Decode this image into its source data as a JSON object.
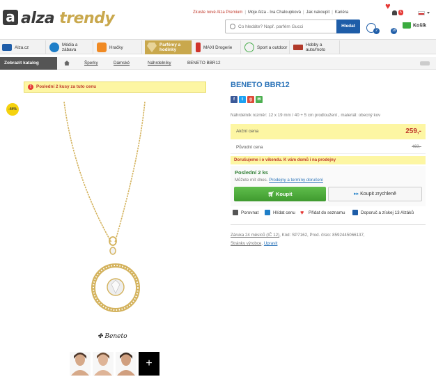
{
  "header": {
    "logo_letter": "a",
    "logo_word1": "alza",
    "logo_word2": "trendy",
    "links": [
      "Zkuste nové Alza Premium",
      "Moje Alza - Iva Chaloupková",
      "Jak nakoupit",
      "Kariéra"
    ],
    "notification_count": "5",
    "search_placeholder": "Co hledáte? Např. parfém Gucci",
    "search_button": "Hledat",
    "compare_count": "2",
    "favorites_count": "18",
    "cart_label": "Košík"
  },
  "nav": [
    {
      "label": "Alza.cz",
      "icon": "laptop-icon",
      "color": "#1e5da8"
    },
    {
      "label": "Média a zábava",
      "icon": "play-icon",
      "color": "#1e7ec8"
    },
    {
      "label": "Hračky",
      "icon": "robot-icon",
      "color": "#f08a24"
    },
    {
      "label": "Parfémy a hodinky",
      "icon": "diamond-icon",
      "color": "#ffffff"
    },
    {
      "label": "MAXI Drogerie",
      "icon": "bottle-icon",
      "color": "#d0342c"
    },
    {
      "label": "Sport a outdoor",
      "icon": "bike-icon",
      "color": "#4caf50"
    },
    {
      "label": "Hobby a auto/moto",
      "icon": "drill-icon",
      "color": "#b13a2a"
    }
  ],
  "breadcrumb": {
    "catalog_button": "Zobrazit katalog",
    "items": [
      "Šperky",
      "Dámské",
      "Náhrdelníky",
      "BENETO BBR12"
    ]
  },
  "product": {
    "stock_alert": "Poslední 2 kusy za tuto cenu",
    "discount": "-44%",
    "brand": "Beneto",
    "title": "BENETO BBR12",
    "description": "Náhrdelník rozměr: 12 x 19 mm / 40 + 5 cm prodloužení , materiál: obecný kov",
    "price_label": "Akční cena",
    "price": "259,-",
    "orig_price_label": "Původní cena",
    "orig_price": "469,-",
    "delivery_banner": "Doručujeme i o víkendu. K vám domů i na prodejny",
    "stock_title": "Poslední 2 ks",
    "stock_sub_prefix": "Můžete mít dnes.",
    "stock_sub_link": "Prodejny a termíny doručení",
    "buy_button": "Koupit",
    "buy_fast_button": "Koupit zrychleně",
    "actions": [
      "Porovnat",
      "Hlídat cenu",
      "Přidat do seznamu",
      "Doporuč a získej 13 Alzáků"
    ],
    "meta_warranty": "Záruka 24 měsíců (IČ 12)",
    "meta_code": ",  Kód: SP7162,  Prod. číslo: 8592445066137,",
    "meta_pages": "Stránky výrobce",
    "meta_edit": "Upravit"
  },
  "colors": {
    "brand_gold": "#c9a84d",
    "link_blue": "#2b73b8",
    "buy_green": "#4caf50",
    "price_red": "#c0392b"
  }
}
